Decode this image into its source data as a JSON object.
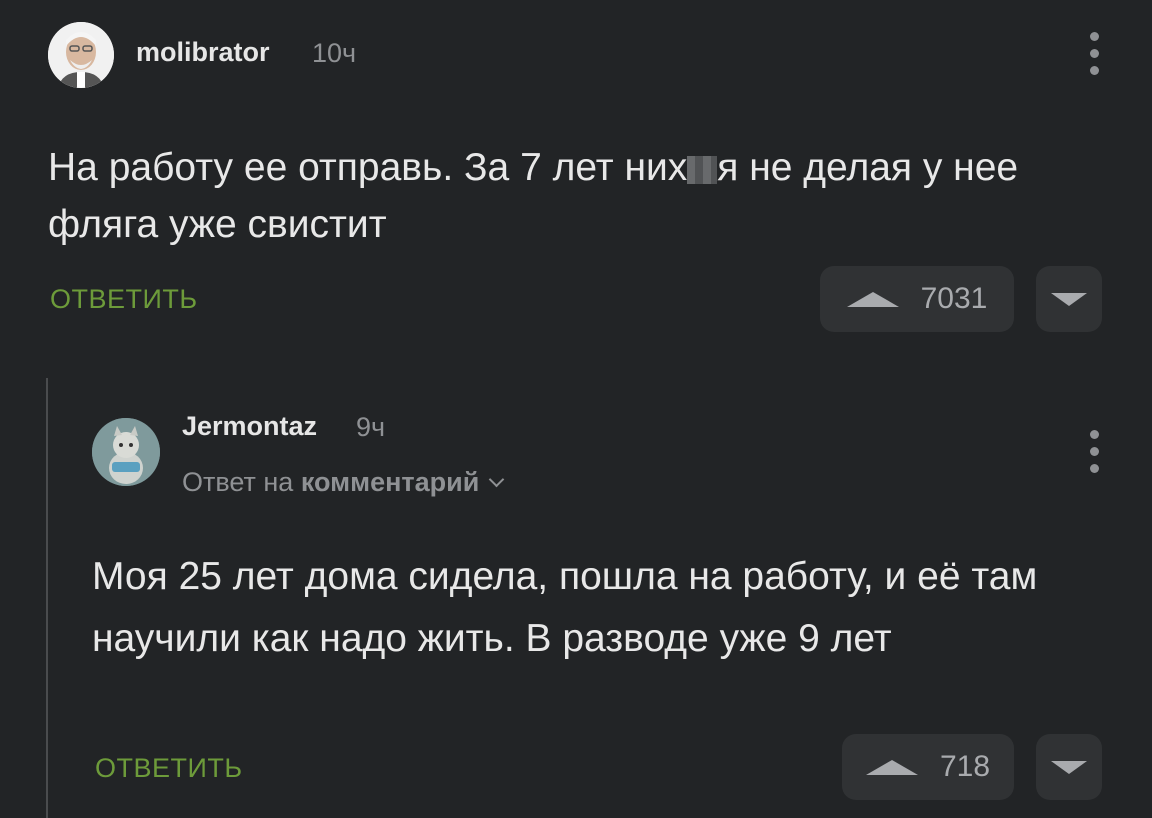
{
  "comment1": {
    "author": "molibrator",
    "time": "10ч",
    "text_before": "На работу ее отправь. За 7 лет них",
    "text_after": "я не делая у нее фляга уже свистит",
    "reply_label": "ОТВЕТИТЬ",
    "vote_count": "7031",
    "avatar_icon": "user-avatar-photo"
  },
  "comment2": {
    "author": "Jermontaz",
    "time": "9ч",
    "reply_to_prefix": "Ответ на",
    "reply_to_link": "комментарий",
    "text": "Моя 25 лет дома сидела, пошла на работу, и её там научили как надо жить. В разводе уже 9 лет",
    "reply_label": "ОТВЕТИТЬ",
    "vote_count": "718",
    "avatar_icon": "cat-avatar-photo"
  },
  "colors": {
    "background": "#222426",
    "accent_green": "#6d9b3a",
    "muted": "#8f9194"
  }
}
